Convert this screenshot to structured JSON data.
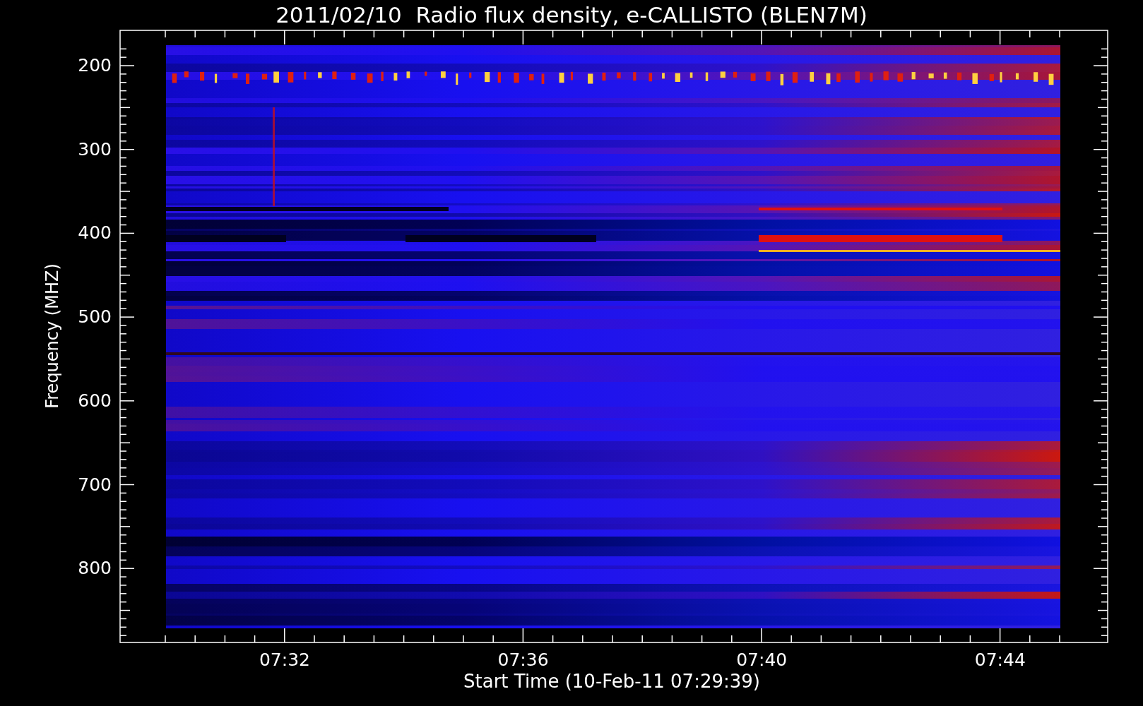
{
  "title": "2011/02/10  Radio flux density, e-CALLISTO (BLEN7M)",
  "y_axis": {
    "label": "Frequency (MHZ)",
    "ticks": [
      "200",
      "300",
      "400",
      "500",
      "600",
      "700",
      "800"
    ]
  },
  "x_axis": {
    "label": "Start Time (10-Feb-11 07:29:39)",
    "ticks": [
      "07:32",
      "07:36",
      "07:40",
      "07:44"
    ]
  }
}
